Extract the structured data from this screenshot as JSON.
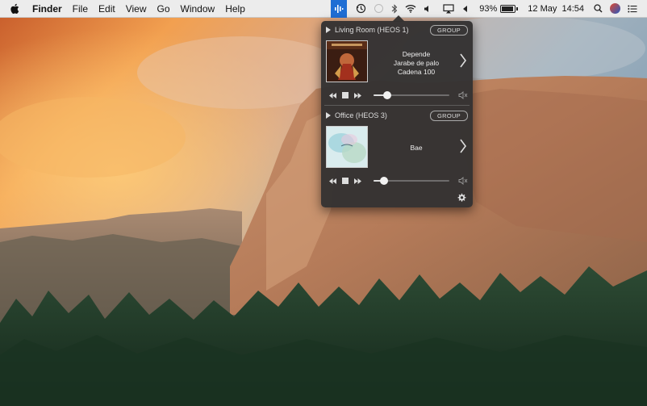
{
  "menubar": {
    "apple_icon": "apple-logo-icon",
    "app_name": "Finder",
    "items": [
      "File",
      "Edit",
      "View",
      "Go",
      "Window",
      "Help"
    ],
    "status": {
      "battery_percent": "93%",
      "battery_level": 0.93,
      "datetime": "12 May  14:54"
    }
  },
  "heos": {
    "zones": [
      {
        "name": "Living Room (HEOS 1)",
        "group_label": "GROUP",
        "track_title": "Depende",
        "artist": "Jarabe de palo",
        "station": "Cadena 100",
        "volume": 0.18
      },
      {
        "name": "Office (HEOS 3)",
        "group_label": "GROUP",
        "track_title": "Bae",
        "artist": "",
        "station": "",
        "volume": 0.14
      }
    ],
    "accent": "#1f6ed4",
    "panel_bg": "#343232"
  }
}
